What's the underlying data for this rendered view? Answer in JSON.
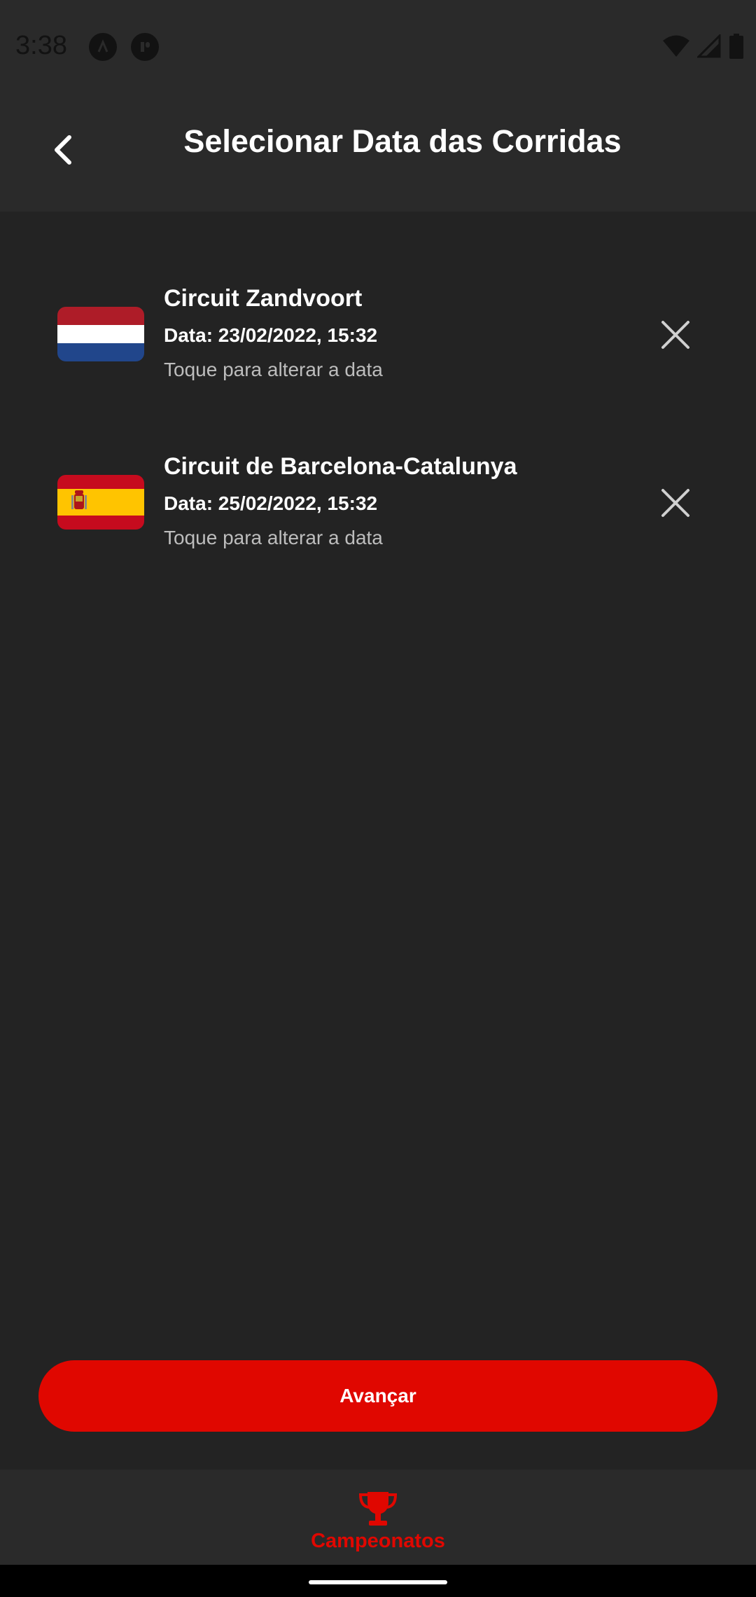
{
  "status_bar": {
    "time": "3:38"
  },
  "header": {
    "title": "Selecionar Data das Corridas"
  },
  "races": [
    {
      "name": "Circuit Zandvoort",
      "date": "Data: 23/02/2022, 15:32",
      "hint": "Toque para alterar a data",
      "flag": "netherlands"
    },
    {
      "name": "Circuit de Barcelona-Catalunya",
      "date": "Data: 25/02/2022, 15:32",
      "hint": "Toque para alterar a data",
      "flag": "spain"
    }
  ],
  "advance_button": {
    "label": "Avançar"
  },
  "bottom_nav": {
    "items": [
      {
        "label": "Campeonatos",
        "icon": "trophy-icon"
      }
    ]
  },
  "colors": {
    "background": "#232323",
    "header": "#2a2a2a",
    "accent": "#e00700",
    "hint_text": "#bdbdbd"
  }
}
